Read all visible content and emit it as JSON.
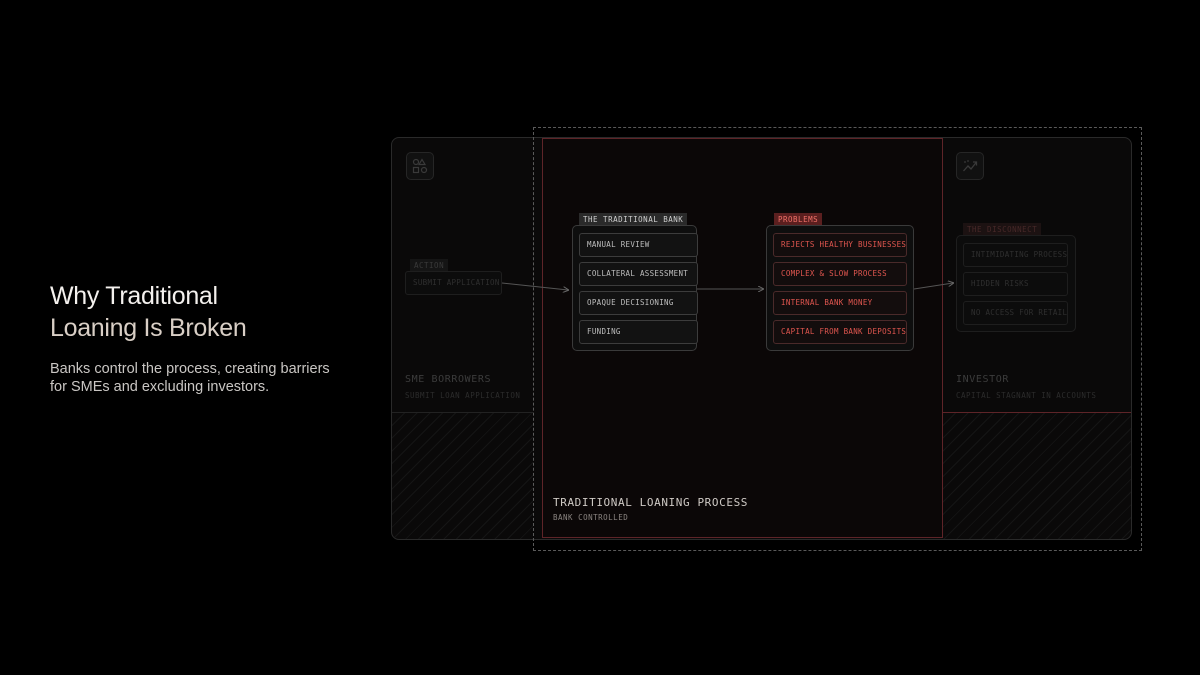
{
  "headline": {
    "line1": "Why Traditional",
    "line2": "Loaning Is Broken"
  },
  "subtitle": "Banks control the process, creating barriers for SMEs and excluding investors.",
  "left_panel": {
    "tag": "ACTION",
    "action": "SUBMIT APPLICATION",
    "title": "SME BORROWERS",
    "subtitle": "SUBMIT LOAN APPLICATION",
    "icon": "shapes-icon"
  },
  "center_panel": {
    "bank": {
      "tag": "THE TRADITIONAL BANK",
      "items": [
        "MANUAL REVIEW",
        "COLLATERAL ASSESSMENT",
        "OPAQUE DECISIONING",
        "FUNDING"
      ]
    },
    "problems": {
      "tag": "PROBLEMS",
      "items": [
        "REJECTS HEALTHY BUSINESSES",
        "COMPLEX & SLOW PROCESS",
        "INTERNAL BANK MONEY",
        "CAPITAL FROM BANK DEPOSITS"
      ]
    },
    "title": "TRADITIONAL LOANING PROCESS",
    "subtitle": "BANK CONTROLLED"
  },
  "right_panel": {
    "tag": "THE DISCONNECT",
    "items": [
      "INTIMIDATING PROCESS",
      "HIDDEN RISKS",
      "NO ACCESS FOR RETAIL"
    ],
    "title": "INVESTOR",
    "subtitle": "CAPITAL STAGNANT IN ACCOUNTS",
    "icon": "chart-trend-icon"
  },
  "colors": {
    "accent_red": "#e0564f",
    "panel_border_red": "#5e2428",
    "background": "#000000"
  }
}
